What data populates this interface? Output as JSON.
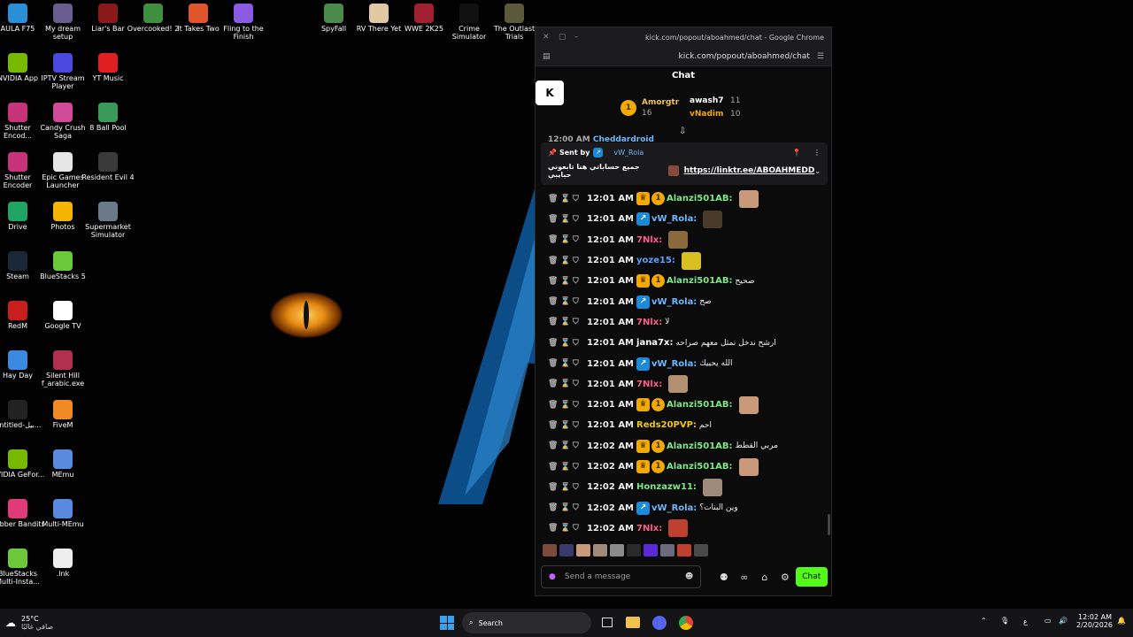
{
  "desktop_icons": [
    {
      "label": "AULA F75",
      "color": "#2b8fd8",
      "col": 0,
      "row": 0
    },
    {
      "label": "My dream setup",
      "color": "#6a5e8e",
      "col": 1,
      "row": 0
    },
    {
      "label": "Liar's Bar",
      "color": "#8a1a1a",
      "col": 2,
      "row": 0
    },
    {
      "label": "Overcooked! 2",
      "color": "#3e8f3e",
      "col": 3,
      "row": 0
    },
    {
      "label": "It Takes Two",
      "color": "#e0562a",
      "col": 4,
      "row": 0
    },
    {
      "label": "Fling to the Finish",
      "color": "#8a5ae0",
      "col": 5,
      "row": 0
    },
    {
      "label": "NVIDIA App",
      "color": "#76b900",
      "col": 0,
      "row": 1
    },
    {
      "label": "IPTV Stream Player",
      "color": "#4a4ae0",
      "col": 1,
      "row": 1
    },
    {
      "label": "YT Music",
      "color": "#e02020",
      "col": 2,
      "row": 1
    },
    {
      "label": "Shutter Encod...",
      "color": "#c8327a",
      "col": 0,
      "row": 2
    },
    {
      "label": "Candy Crush Saga",
      "color": "#d04a9a",
      "col": 1,
      "row": 2
    },
    {
      "label": "8 Ball Pool",
      "color": "#3a9a5a",
      "col": 2,
      "row": 2
    },
    {
      "label": "Shutter Encoder",
      "color": "#c8327a",
      "col": 0,
      "row": 3
    },
    {
      "label": "Epic Games Launcher",
      "color": "#e6e6e6",
      "col": 1,
      "row": 3
    },
    {
      "label": "Resident Evil 4",
      "color": "#3a3a3a",
      "col": 2,
      "row": 3
    },
    {
      "label": "Drive",
      "color": "#1fa463",
      "col": 0,
      "row": 4
    },
    {
      "label": "Photos",
      "color": "#f4b400",
      "col": 1,
      "row": 4
    },
    {
      "label": "Supermarket Simulator",
      "color": "#6a7a8a",
      "col": 2,
      "row": 4
    },
    {
      "label": "Steam",
      "color": "#1b2838",
      "col": 0,
      "row": 5
    },
    {
      "label": "BlueStacks 5",
      "color": "#6ac83a",
      "col": 1,
      "row": 5
    },
    {
      "label": "RedM",
      "color": "#c81e1e",
      "col": 0,
      "row": 6
    },
    {
      "label": "Google TV",
      "color": "#ffffff",
      "col": 1,
      "row": 6
    },
    {
      "label": "Hay Day",
      "color": "#3a8ae0",
      "col": 0,
      "row": 7
    },
    {
      "label": "Silent Hill f_arabic.exe",
      "color": "#b03050",
      "col": 1,
      "row": 7
    },
    {
      "label": "Untitled-بيل...",
      "color": "#222222",
      "col": 0,
      "row": 8
    },
    {
      "label": "FiveM",
      "color": "#f08a24",
      "col": 1,
      "row": 8
    },
    {
      "label": "NVIDIA GeFor...",
      "color": "#76b900",
      "col": 0,
      "row": 9
    },
    {
      "label": "MEmu",
      "color": "#5a8ae0",
      "col": 1,
      "row": 9
    },
    {
      "label": "Rubber Bandits",
      "color": "#e03a7a",
      "col": 0,
      "row": 10
    },
    {
      "label": "Multi-MEmu",
      "color": "#5a8ae0",
      "col": 1,
      "row": 10
    },
    {
      "label": "BlueStacks Multi-Insta...",
      "color": "#6ac83a",
      "col": 0,
      "row": 11
    },
    {
      "label": ".lnk",
      "color": "#eeeeee",
      "col": 1,
      "row": 11
    },
    {
      "label": "SpyFall",
      "color": "#4a8a4a",
      "col": 7,
      "row": 0
    },
    {
      "label": "RV There Yet",
      "color": "#e0c8a0",
      "col": 8,
      "row": 0
    },
    {
      "label": "WWE 2K25",
      "color": "#a02030",
      "col": 9,
      "row": 0
    },
    {
      "label": "Crime Simulator",
      "color": "#111111",
      "col": 10,
      "row": 0
    },
    {
      "label": "The Outlast Trials",
      "color": "#5a5a3a",
      "col": 11,
      "row": 0
    }
  ],
  "window": {
    "title": "kick.com/popout/aboahmed/chat - Google Chrome",
    "url": "kick.com/popout/aboahmed/chat",
    "chat_header": "Chat"
  },
  "leaderboard": [
    {
      "rank": "1",
      "name": "Amorgtr",
      "count": "16"
    },
    {
      "name": "awash7",
      "count": "11"
    },
    {
      "name": "vNadim",
      "count": "10"
    }
  ],
  "clipped_line": {
    "time": "12:00 AM",
    "user": "Cheddardroid"
  },
  "pinned": {
    "sent_by_label": "Sent by",
    "sender": "vW_Rola",
    "text": "جميع حساباتي هنا تابعوني حبايبي",
    "link": "https://linktr.ee/ABOAHMEDD"
  },
  "messages": [
    {
      "time": "12:01 AM",
      "badges": [
        "crown",
        "one"
      ],
      "user": "Alanzi501AB:",
      "user_color": "#7ee787",
      "text": "",
      "emote": "#c89a7a"
    },
    {
      "time": "12:01 AM",
      "badges": [
        "blue"
      ],
      "user": "vW_Rola:",
      "user_color": "#6cb8ff",
      "text": "",
      "emote": "#4a3a2a"
    },
    {
      "time": "12:01 AM",
      "badges": [],
      "user": "7Nlx:",
      "user_color": "#ff5c8a",
      "text": "",
      "emote": "#8a6a3a"
    },
    {
      "time": "12:01 AM",
      "badges": [],
      "user": "yoze15:",
      "user_color": "#5aa0ff",
      "text": "",
      "emote": "#d8c020"
    },
    {
      "time": "12:01 AM",
      "badges": [
        "crown",
        "one"
      ],
      "user": "Alanzi501AB:",
      "user_color": "#7ee787",
      "text": "صحيح",
      "emote": ""
    },
    {
      "time": "12:01 AM",
      "badges": [
        "blue"
      ],
      "user": "vW_Rola:",
      "user_color": "#6cb8ff",
      "text": "صح",
      "emote": ""
    },
    {
      "time": "12:01 AM",
      "badges": [],
      "user": "7Nlx:",
      "user_color": "#ff5c8a",
      "text": "لا",
      "emote": ""
    },
    {
      "time": "12:01 AM",
      "badges": [],
      "user": "jana7x:",
      "user_color": "#ffffff",
      "text": "ارشح ندخل نمثل معهم صراحه",
      "emote": ""
    },
    {
      "time": "12:01 AM",
      "badges": [
        "blue"
      ],
      "user": "vW_Rola:",
      "user_color": "#6cb8ff",
      "text": "الله يحييك",
      "emote": ""
    },
    {
      "time": "12:01 AM",
      "badges": [],
      "user": "7Nlx:",
      "user_color": "#ff5c8a",
      "text": "",
      "emote": "#b09070"
    },
    {
      "time": "12:01 AM",
      "badges": [
        "crown",
        "one"
      ],
      "user": "Alanzi501AB:",
      "user_color": "#7ee787",
      "text": "",
      "emote": "#c89a7a"
    },
    {
      "time": "12:01 AM",
      "badges": [],
      "user": "Reds20PVP:",
      "user_color": "#f0c419",
      "text": "احم",
      "emote": ""
    },
    {
      "time": "12:02 AM",
      "badges": [
        "crown",
        "one"
      ],
      "user": "Alanzi501AB:",
      "user_color": "#7ee787",
      "text": "مربي القطط",
      "emote": ""
    },
    {
      "time": "12:02 AM",
      "badges": [
        "crown",
        "one"
      ],
      "user": "Alanzi501AB:",
      "user_color": "#7ee787",
      "text": "",
      "emote": "#c89a7a"
    },
    {
      "time": "12:02 AM",
      "badges": [],
      "user": "Honzazw11:",
      "user_color": "#7ee787",
      "text": "",
      "emote": "#a08a7a"
    },
    {
      "time": "12:02 AM",
      "badges": [
        "blue"
      ],
      "user": "vW_Rola:",
      "user_color": "#6cb8ff",
      "text": "وين البنات؟",
      "emote": ""
    },
    {
      "time": "12:02 AM",
      "badges": [],
      "user": "7Nlx:",
      "user_color": "#ff5c8a",
      "text": "",
      "emote": "#c04030"
    }
  ],
  "input": {
    "placeholder": "Send a message",
    "chat_button": "Chat"
  },
  "taskbar": {
    "weather_temp": "25°C",
    "weather_desc": "صافي غالبًا",
    "search_label": "Search",
    "lang": "ع",
    "time": "12:02 AM",
    "date": "2/20/2026"
  },
  "colors": {
    "kick_green": "#53fc18",
    "gold_badge": "#f2a900",
    "blue_badge": "#1c8ad6"
  }
}
